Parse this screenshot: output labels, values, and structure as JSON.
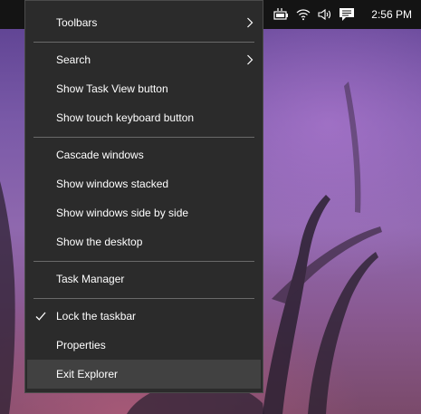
{
  "taskbar": {
    "tray_icons": [
      "battery-plugged-icon",
      "wifi-icon",
      "volume-icon",
      "action-center-icon"
    ],
    "clock": "2:56 PM"
  },
  "context_menu": {
    "items": [
      {
        "label": "Toolbars",
        "submenu": true
      },
      {
        "label": "Search",
        "submenu": true
      },
      {
        "label": "Show Task View button"
      },
      {
        "label": "Show touch keyboard button"
      },
      {
        "label": "Cascade windows"
      },
      {
        "label": "Show windows stacked"
      },
      {
        "label": "Show windows side by side"
      },
      {
        "label": "Show the desktop"
      },
      {
        "label": "Task Manager"
      },
      {
        "label": "Lock the taskbar",
        "checked": true
      },
      {
        "label": "Properties"
      },
      {
        "label": "Exit Explorer",
        "highlighted": true
      }
    ]
  },
  "colors": {
    "menu_bg": "#2b2b2b",
    "menu_hover": "#414141",
    "taskbar_bg": "#141414",
    "menu_text": "#ffffff"
  }
}
